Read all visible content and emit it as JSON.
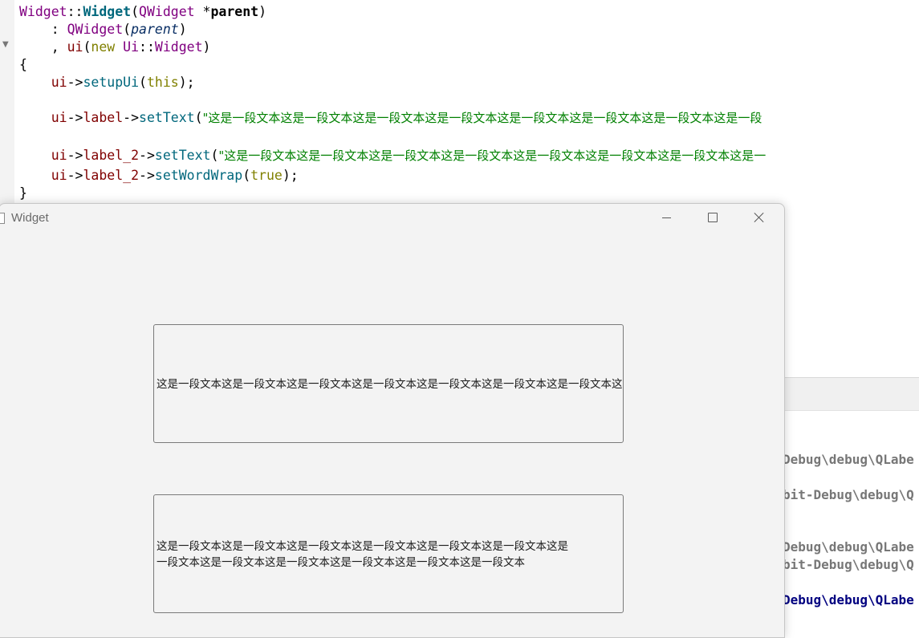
{
  "editor": {
    "line1": {
      "a": "Widget",
      "b": "::",
      "c": "Widget",
      "d": "(",
      "e": "QWidget",
      "f": " *",
      "g": "parent",
      "h": ")"
    },
    "line2": {
      "a": "    : ",
      "b": "QWidget",
      "c": "(",
      "d": "parent",
      "e": ")"
    },
    "line3": {
      "a": "    , ",
      "b": "ui",
      "c": "(",
      "d": "new",
      "e": " ",
      "f": "Ui",
      "g": "::",
      "h": "Widget",
      "i": ")"
    },
    "line4": "{",
    "line5": {
      "a": "    ui",
      "b": "->",
      "c": "setupUi",
      "d": "(",
      "e": "this",
      "f": ");"
    },
    "line6": {
      "a": "    ui",
      "b": "->",
      "c": "label",
      "d": "->",
      "e": "setText",
      "f": "(",
      "g": "\"这是一段文本这是一段文本这是一段文本这是一段文本这是一段文本这是一段文本这是一段文本这是一段"
    },
    "line7": {
      "a": "    ui",
      "b": "->",
      "c": "label_2",
      "d": "->",
      "e": "setText",
      "f": "(",
      "g": "\"这是一段文本这是一段文本这是一段文本这是一段文本这是一段文本这是一段文本这是一段文本这是一"
    },
    "line8": {
      "a": "    ui",
      "b": "->",
      "c": "label_2",
      "d": "->",
      "e": "setWordWrap",
      "f": "(",
      "g": "true",
      "h": ");"
    },
    "line9": "}"
  },
  "output": {
    "lines": [
      "Debug\\debug\\QLabe",
      "bit-Debug\\debug\\Q",
      "Debug\\debug\\QLabe",
      "bit-Debug\\debug\\Q",
      "Debug\\debug\\QLabe"
    ]
  },
  "window": {
    "title": "Widget",
    "label1_text": "这是一段文本这是一段文本这是一段文本这是一段文本这是一段文本这是一段文本这是一段文本这是一段文本",
    "label2_line1": "这是一段文本这是一段文本这是一段文本这是一段文本这是一段文本这是一段文本这是",
    "label2_line2": "一段文本这是一段文本这是一段文本这是一段文本这是一段文本这是一段文本"
  },
  "colors": {
    "string": "#008000",
    "keyword": "#808000",
    "type": "#800080",
    "member": "#800000",
    "function": "#00677c"
  },
  "icons": [
    "fold-arrow-icon",
    "app-icon",
    "minimize-icon",
    "maximize-icon",
    "close-icon"
  ]
}
